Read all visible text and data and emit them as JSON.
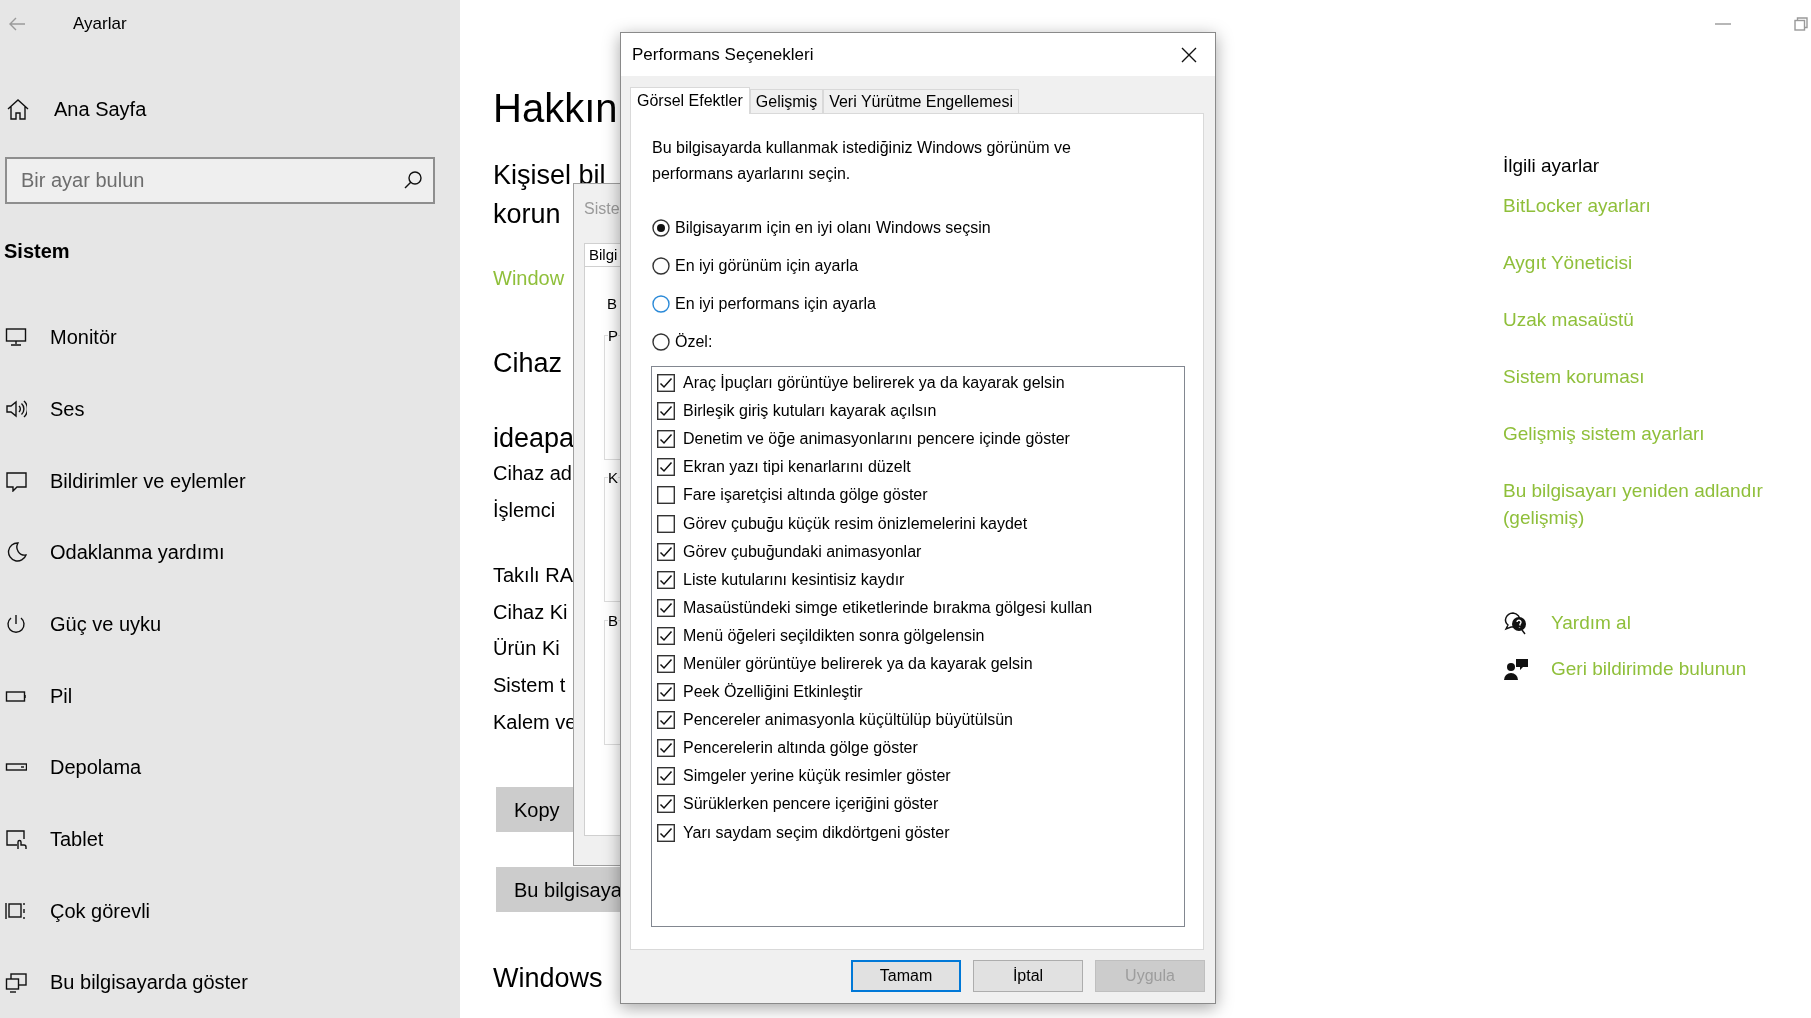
{
  "settings_window": {
    "title": "Ayarlar",
    "home": "Ana Sayfa",
    "search": {
      "placeholder": "Bir ayar bulun"
    },
    "section": "Sistem",
    "nav_items": [
      {
        "label": "Monitör",
        "kind": "monitor"
      },
      {
        "label": "Ses",
        "kind": "sound"
      },
      {
        "label": "Bildirimler ve eylemler",
        "kind": "notifications"
      },
      {
        "label": "Odaklanma yardımı",
        "kind": "focus"
      },
      {
        "label": "Güç ve uyku",
        "kind": "power"
      },
      {
        "label": "Pil",
        "kind": "battery"
      },
      {
        "label": "Depolama",
        "kind": "storage"
      },
      {
        "label": "Tablet",
        "kind": "tablet"
      },
      {
        "label": "Çok görevli",
        "kind": "multitasking"
      },
      {
        "label": "Bu bilgisayarda göster",
        "kind": "project"
      }
    ]
  },
  "about_page": [
    {
      "text": "Hakkın",
      "kind": "title"
    },
    {
      "text": "Kişisel bil",
      "kind": "subtitle"
    },
    {
      "text": "korun",
      "kind": "subtitle"
    },
    {
      "text": "Window",
      "kind": "link"
    },
    {
      "text": "Cihaz",
      "kind": "subtitle"
    },
    {
      "text": "ideapa",
      "kind": "subtitle"
    },
    {
      "text": "Cihaz ad",
      "kind": "text"
    },
    {
      "text": "İşlemci",
      "kind": "text"
    },
    {
      "text": "Takılı RA",
      "kind": "text"
    },
    {
      "text": "Cihaz Ki",
      "kind": "text"
    },
    {
      "text": "Ürün Ki",
      "kind": "text"
    },
    {
      "text": "Sistem t",
      "kind": "text"
    },
    {
      "text": "Kalem ve",
      "kind": "text"
    },
    {
      "text": "Kopy",
      "kind": "button"
    },
    {
      "text": "Bu bilgisaya",
      "kind": "button"
    },
    {
      "text": "Windows",
      "kind": "subtitle"
    }
  ],
  "system_properties_window": {
    "title": "Siste",
    "tab": "Bilgi",
    "texts": [
      "B",
      "P",
      "K",
      "B"
    ]
  },
  "performance_dialog": {
    "title": "Performans Seçenekleri",
    "tabs": [
      {
        "label": "Görsel Efektler",
        "selected": true
      },
      {
        "label": "Gelişmiş",
        "selected": false
      },
      {
        "label": "Veri Yürütme Engellemesi",
        "selected": false
      }
    ],
    "description": "Bu bilgisayarda kullanmak istediğiniz Windows görünüm ve performans ayarlarını seçin.",
    "radios": [
      {
        "label": "Bilgisayarım için en iyi olanı Windows seçsin",
        "selected": true,
        "hovered": false
      },
      {
        "label": "En iyi görünüm için ayarla",
        "selected": false,
        "hovered": false
      },
      {
        "label": "En iyi performans için ayarla",
        "selected": false,
        "hovered": true
      },
      {
        "label": "Özel:",
        "selected": false,
        "hovered": false
      }
    ],
    "effects": [
      {
        "label": "Araç İpuçları görüntüye belirerek ya da kayarak gelsin",
        "checked": true
      },
      {
        "label": "Birleşik giriş kutuları kayarak açılsın",
        "checked": true
      },
      {
        "label": "Denetim ve öğe animasyonlarını pencere içinde göster",
        "checked": true
      },
      {
        "label": "Ekran yazı tipi kenarlarını düzelt",
        "checked": true
      },
      {
        "label": "Fare işaretçisi altında gölge göster",
        "checked": false
      },
      {
        "label": "Görev çubuğu küçük resim önizlemelerini kaydet",
        "checked": false
      },
      {
        "label": "Görev çubuğundaki animasyonlar",
        "checked": true
      },
      {
        "label": "Liste kutularını kesintisiz kaydır",
        "checked": true
      },
      {
        "label": "Masaüstündeki simge etiketlerinde bırakma gölgesi kullan",
        "checked": true
      },
      {
        "label": "Menü öğeleri seçildikten sonra gölgelensin",
        "checked": true
      },
      {
        "label": "Menüler görüntüye belirerek ya da kayarak gelsin",
        "checked": true
      },
      {
        "label": "Peek Özelliğini Etkinleştir",
        "checked": true
      },
      {
        "label": "Pencereler animasyonla küçültülüp büyütülsün",
        "checked": true
      },
      {
        "label": "Pencerelerin altında gölge göster",
        "checked": true
      },
      {
        "label": "Simgeler yerine küçük resimler göster",
        "checked": true
      },
      {
        "label": "Sürüklerken pencere içeriğini göster",
        "checked": true
      },
      {
        "label": "Yarı saydam seçim dikdörtgeni göster",
        "checked": true
      }
    ],
    "buttons": [
      {
        "label": "Tamam",
        "default": true,
        "disabled": false
      },
      {
        "label": "İptal",
        "default": false,
        "disabled": false
      },
      {
        "label": "Uygula",
        "default": false,
        "disabled": true
      }
    ]
  },
  "related_settings": {
    "title": "İlgili ayarlar",
    "links": [
      "BitLocker ayarları",
      "Aygıt Yöneticisi",
      "Uzak masaüstü",
      "Sistem koruması",
      "Gelişmiş sistem ayarları",
      "Bu bilgisayarı yeniden adlandır (gelişmiş)"
    ]
  },
  "support_links": [
    {
      "label": "Yardım al",
      "kind": "help"
    },
    {
      "label": "Geri bildirimde bulunun",
      "kind": "feedback"
    }
  ]
}
